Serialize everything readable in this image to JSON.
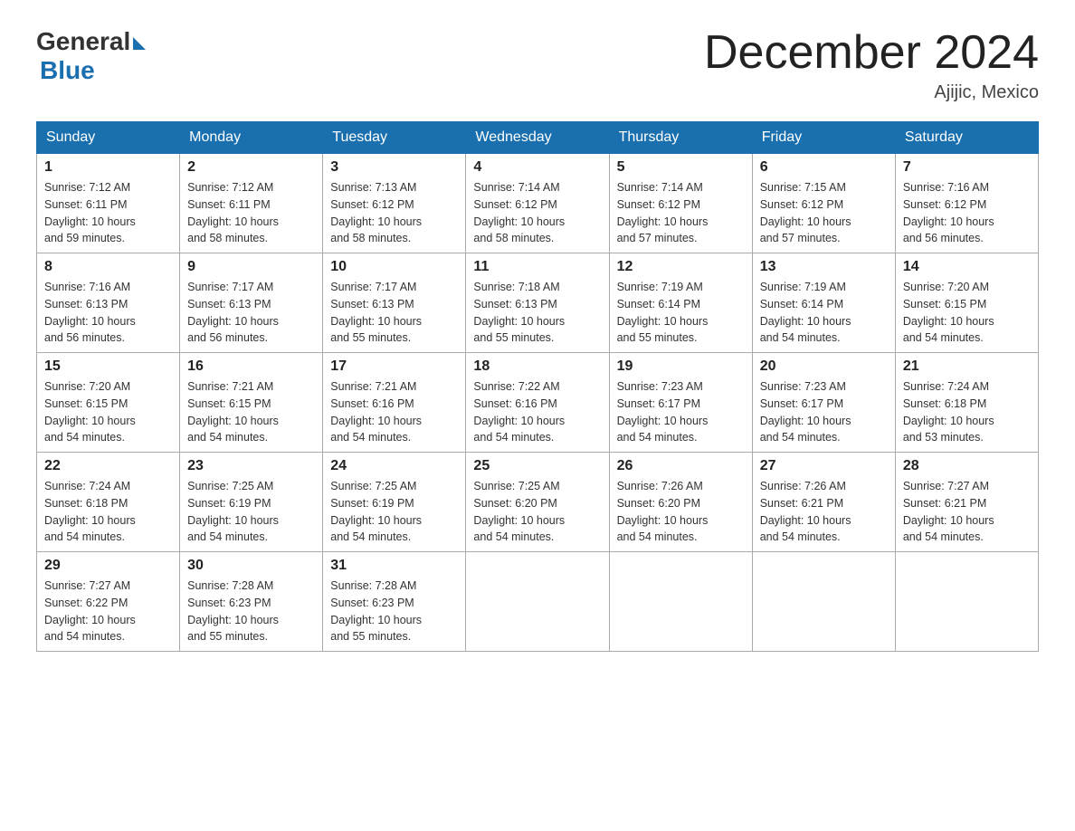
{
  "logo": {
    "general": "General",
    "blue": "Blue",
    "subtitle": "Blue"
  },
  "header": {
    "month_title": "December 2024",
    "location": "Ajijic, Mexico"
  },
  "weekdays": [
    "Sunday",
    "Monday",
    "Tuesday",
    "Wednesday",
    "Thursday",
    "Friday",
    "Saturday"
  ],
  "weeks": [
    [
      {
        "day": "1",
        "sunrise": "7:12 AM",
        "sunset": "6:11 PM",
        "daylight": "10 hours and 59 minutes."
      },
      {
        "day": "2",
        "sunrise": "7:12 AM",
        "sunset": "6:11 PM",
        "daylight": "10 hours and 58 minutes."
      },
      {
        "day": "3",
        "sunrise": "7:13 AM",
        "sunset": "6:12 PM",
        "daylight": "10 hours and 58 minutes."
      },
      {
        "day": "4",
        "sunrise": "7:14 AM",
        "sunset": "6:12 PM",
        "daylight": "10 hours and 58 minutes."
      },
      {
        "day": "5",
        "sunrise": "7:14 AM",
        "sunset": "6:12 PM",
        "daylight": "10 hours and 57 minutes."
      },
      {
        "day": "6",
        "sunrise": "7:15 AM",
        "sunset": "6:12 PM",
        "daylight": "10 hours and 57 minutes."
      },
      {
        "day": "7",
        "sunrise": "7:16 AM",
        "sunset": "6:12 PM",
        "daylight": "10 hours and 56 minutes."
      }
    ],
    [
      {
        "day": "8",
        "sunrise": "7:16 AM",
        "sunset": "6:13 PM",
        "daylight": "10 hours and 56 minutes."
      },
      {
        "day": "9",
        "sunrise": "7:17 AM",
        "sunset": "6:13 PM",
        "daylight": "10 hours and 56 minutes."
      },
      {
        "day": "10",
        "sunrise": "7:17 AM",
        "sunset": "6:13 PM",
        "daylight": "10 hours and 55 minutes."
      },
      {
        "day": "11",
        "sunrise": "7:18 AM",
        "sunset": "6:13 PM",
        "daylight": "10 hours and 55 minutes."
      },
      {
        "day": "12",
        "sunrise": "7:19 AM",
        "sunset": "6:14 PM",
        "daylight": "10 hours and 55 minutes."
      },
      {
        "day": "13",
        "sunrise": "7:19 AM",
        "sunset": "6:14 PM",
        "daylight": "10 hours and 54 minutes."
      },
      {
        "day": "14",
        "sunrise": "7:20 AM",
        "sunset": "6:15 PM",
        "daylight": "10 hours and 54 minutes."
      }
    ],
    [
      {
        "day": "15",
        "sunrise": "7:20 AM",
        "sunset": "6:15 PM",
        "daylight": "10 hours and 54 minutes."
      },
      {
        "day": "16",
        "sunrise": "7:21 AM",
        "sunset": "6:15 PM",
        "daylight": "10 hours and 54 minutes."
      },
      {
        "day": "17",
        "sunrise": "7:21 AM",
        "sunset": "6:16 PM",
        "daylight": "10 hours and 54 minutes."
      },
      {
        "day": "18",
        "sunrise": "7:22 AM",
        "sunset": "6:16 PM",
        "daylight": "10 hours and 54 minutes."
      },
      {
        "day": "19",
        "sunrise": "7:23 AM",
        "sunset": "6:17 PM",
        "daylight": "10 hours and 54 minutes."
      },
      {
        "day": "20",
        "sunrise": "7:23 AM",
        "sunset": "6:17 PM",
        "daylight": "10 hours and 54 minutes."
      },
      {
        "day": "21",
        "sunrise": "7:24 AM",
        "sunset": "6:18 PM",
        "daylight": "10 hours and 53 minutes."
      }
    ],
    [
      {
        "day": "22",
        "sunrise": "7:24 AM",
        "sunset": "6:18 PM",
        "daylight": "10 hours and 54 minutes."
      },
      {
        "day": "23",
        "sunrise": "7:25 AM",
        "sunset": "6:19 PM",
        "daylight": "10 hours and 54 minutes."
      },
      {
        "day": "24",
        "sunrise": "7:25 AM",
        "sunset": "6:19 PM",
        "daylight": "10 hours and 54 minutes."
      },
      {
        "day": "25",
        "sunrise": "7:25 AM",
        "sunset": "6:20 PM",
        "daylight": "10 hours and 54 minutes."
      },
      {
        "day": "26",
        "sunrise": "7:26 AM",
        "sunset": "6:20 PM",
        "daylight": "10 hours and 54 minutes."
      },
      {
        "day": "27",
        "sunrise": "7:26 AM",
        "sunset": "6:21 PM",
        "daylight": "10 hours and 54 minutes."
      },
      {
        "day": "28",
        "sunrise": "7:27 AM",
        "sunset": "6:21 PM",
        "daylight": "10 hours and 54 minutes."
      }
    ],
    [
      {
        "day": "29",
        "sunrise": "7:27 AM",
        "sunset": "6:22 PM",
        "daylight": "10 hours and 54 minutes."
      },
      {
        "day": "30",
        "sunrise": "7:28 AM",
        "sunset": "6:23 PM",
        "daylight": "10 hours and 55 minutes."
      },
      {
        "day": "31",
        "sunrise": "7:28 AM",
        "sunset": "6:23 PM",
        "daylight": "10 hours and 55 minutes."
      },
      null,
      null,
      null,
      null
    ]
  ],
  "labels": {
    "sunrise": "Sunrise:",
    "sunset": "Sunset:",
    "daylight": "Daylight:"
  }
}
